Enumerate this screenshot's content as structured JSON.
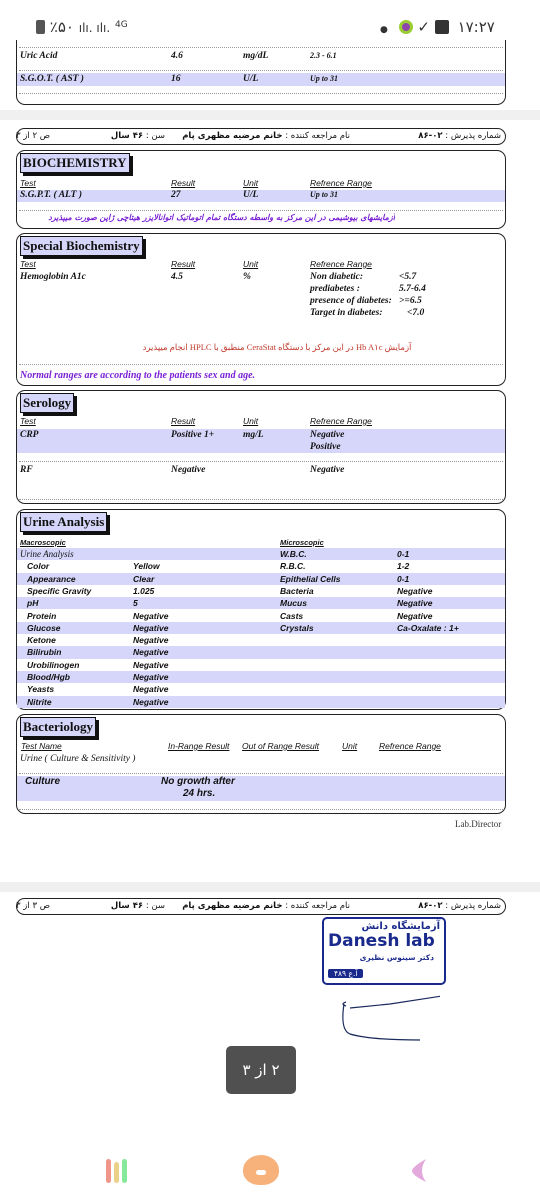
{
  "status_bar": {
    "battery": "٪۵۰",
    "network": "4G",
    "time": "۱۷:۲۷",
    "icons": [
      "battery-icon",
      "signal-icon",
      "signal-icon",
      "network-4g-icon",
      "dot-icon",
      "app-leaf-icon",
      "download-done-icon",
      "image-icon"
    ]
  },
  "page1_tail": {
    "rows": [
      {
        "test": "Uric Acid",
        "result": "4.6",
        "unit": "mg/dL",
        "range": "2.3 - 6.1"
      },
      {
        "test": "S.G.O.T. ( AST )",
        "result": "16",
        "unit": "U/L",
        "range": "Up to 31"
      }
    ]
  },
  "patient_header": {
    "admission_label": "شماره پذیرش :",
    "admission_no": "۰۲-۸۶",
    "name_label": "نام مراجعه کننده :",
    "name": "خانم مرضیه مظهری پام",
    "age_label": "سن :",
    "age": "۴۶ سال",
    "page2": "ص ۲ از ۳",
    "page3": "ص ۳ از ۳"
  },
  "headers": {
    "test": "Test",
    "result": "Result",
    "unit": "Unit",
    "range": "Refrence Range"
  },
  "biochemistry": {
    "title": "BIOCHEMISTRY",
    "row": {
      "test": "S.G.P.T. ( ALT )",
      "result": "27",
      "unit": "U/L",
      "range": "Up to 31"
    },
    "note": "آزمایشهای بیوشیمی در این مرکز به واسطه دستگاه تمام اتوماتیک اتوانالایزر هیتاچی ژاپن صورت میپذیرد"
  },
  "special_biochemistry": {
    "title": "Special Biochemistry",
    "row": {
      "test": "Hemoglobin A1c",
      "result": "4.5",
      "unit": "%"
    },
    "ranges": [
      {
        "label": "Non diabetic:",
        "value": "<5.7"
      },
      {
        "label": "prediabetes :",
        "value": "5.7-6.4"
      },
      {
        "label": "presence of diabetes:",
        "value": ">=6.5"
      },
      {
        "label": "Target in diabetes:",
        "value": "<7.0"
      }
    ],
    "note": "آزمایش Hb A۱c در این مرکز با دستگاه CeraStat منطبق با HPLC انجام میپذیرد",
    "footer": "Normal ranges are according to the patients sex and age."
  },
  "serology": {
    "title": "Serology",
    "rows": [
      {
        "test": "CRP",
        "result": "Positive 1+",
        "unit": "mg/L",
        "range": "Negative",
        "range2": "Positive"
      },
      {
        "test": "RF",
        "result": "Negative",
        "unit": "",
        "range": "Negative"
      }
    ]
  },
  "urine": {
    "title": "Urine Analysis",
    "macro_header": "Macroscopic",
    "micro_header": "Microscopic",
    "group": "Urine Analysis",
    "macro": [
      [
        "Color",
        "Yellow"
      ],
      [
        "Appearance",
        "Clear"
      ],
      [
        "Specific Gravity",
        "1.025"
      ],
      [
        "pH",
        "5"
      ],
      [
        "Protein",
        "Negative"
      ],
      [
        "Glucose",
        "Negative"
      ],
      [
        "Ketone",
        "Negative"
      ],
      [
        "Bilirubin",
        "Negative"
      ],
      [
        "Urobilinogen",
        "Negative"
      ],
      [
        "Blood/Hgb",
        "Negative"
      ],
      [
        "Yeasts",
        "Negative"
      ],
      [
        "Nitrite",
        "Negative"
      ]
    ],
    "micro": [
      [
        "W.B.C.",
        "0-1"
      ],
      [
        "R.B.C.",
        "1-2"
      ],
      [
        "Epithelial Cells",
        "0-1"
      ],
      [
        "Bacteria",
        "Negative"
      ],
      [
        "Mucus",
        "Negative"
      ],
      [
        "Casts",
        "Negative"
      ],
      [
        "Crystals",
        "Ca-Oxalate : 1+"
      ]
    ]
  },
  "bacteriology": {
    "title": "Bacteriology",
    "headers": {
      "test": "Test Name",
      "in": "In-Range Result",
      "out": "Out of Range Result",
      "unit": "Unit",
      "range": "Refrence Range"
    },
    "test": "Urine ( Culture & Sensitivity )",
    "row": {
      "name": "Culture",
      "result1": "No growth after",
      "result2": "24 hrs."
    }
  },
  "lab_director": "Lab.Director",
  "stamp": {
    "line1": "آزمایشگاه دانش",
    "line2": "Danesh lab",
    "line3": "دکتر سینوس نظیری",
    "line4": "آ.ع ۴۸۹"
  },
  "toast": "۲ از ۳",
  "colors": {
    "highlight": "#d6d6fa",
    "purple_note": "#7a1fd6",
    "red_note": "#c0392b",
    "stamp": "#1a2a8c"
  },
  "nav": {
    "icons": [
      "recent-apps-icon",
      "home-icon",
      "back-icon"
    ]
  }
}
